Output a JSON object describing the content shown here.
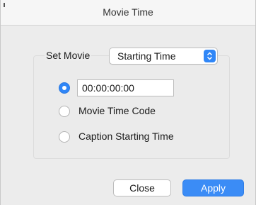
{
  "window": {
    "title": "Movie Time"
  },
  "set_movie": {
    "label": "Set Movie",
    "popup_value": "Starting Time"
  },
  "options": {
    "timecode_value": "00:00:00:00",
    "movie_time_code_label": "Movie Time Code",
    "caption_starting_time_label": "Caption Starting Time",
    "selected": "timecode"
  },
  "buttons": {
    "close_label": "Close",
    "apply_label": "Apply"
  },
  "colors": {
    "accent": "#2f86f7",
    "window_bg": "#ececec"
  }
}
